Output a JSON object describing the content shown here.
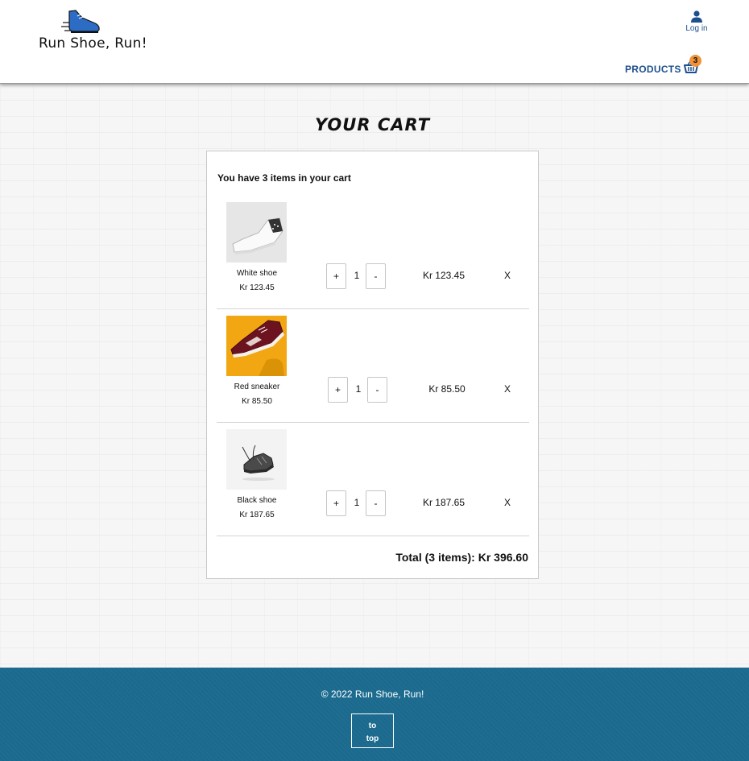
{
  "header": {
    "logo_text": "Run Shoe, Run!",
    "login_label": "Log in",
    "nav_products": "PRODUCTS",
    "cart_count": "3"
  },
  "main": {
    "title": "Your cart",
    "summary": "You have 3 items in your cart",
    "items": [
      {
        "name": "White shoe",
        "unit_price": "Kr 123.45",
        "quantity": "1",
        "line_total": "Kr 123.45",
        "increment": "+",
        "decrement": "-",
        "remove": "X"
      },
      {
        "name": "Red sneaker",
        "unit_price": "Kr 85.50",
        "quantity": "1",
        "line_total": "Kr 85.50",
        "increment": "+",
        "decrement": "-",
        "remove": "X"
      },
      {
        "name": "Black shoe",
        "unit_price": "Kr 187.65",
        "quantity": "1",
        "line_total": "Kr 187.65",
        "increment": "+",
        "decrement": "-",
        "remove": "X"
      }
    ],
    "total": "Total (3 items): Kr 396.60"
  },
  "footer": {
    "copyright": "© 2022 Run Shoe, Run!",
    "to_top_line1": "to",
    "to_top_line2": "top"
  },
  "colors": {
    "brand_blue": "#1c4f8c",
    "footer_bg": "#1b6a8e",
    "badge_orange": "#f0923a"
  },
  "icons": {
    "logo": "running-shoe-icon",
    "login": "user-icon",
    "cart": "basket-icon"
  }
}
